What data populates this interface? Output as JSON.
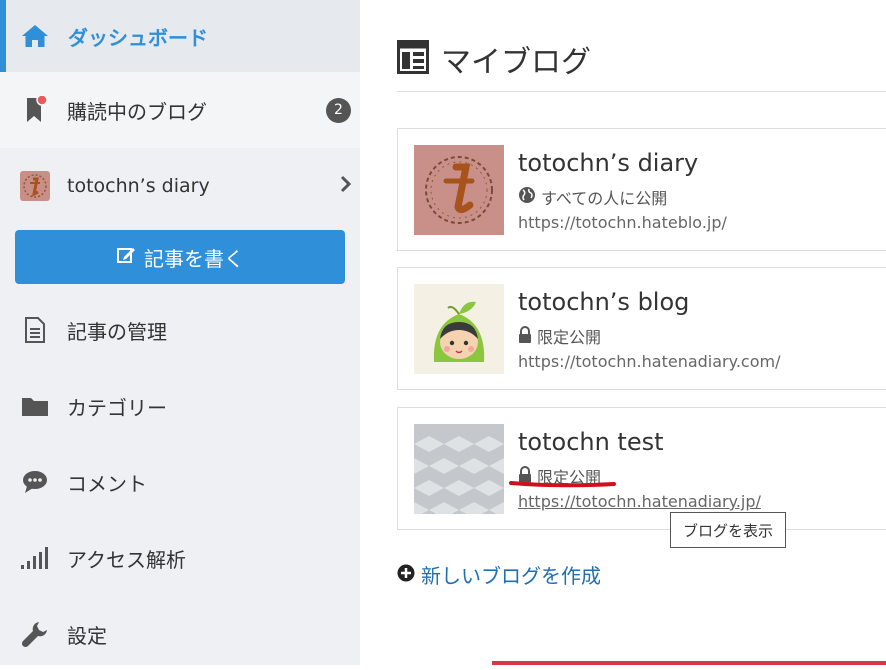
{
  "sidebar": {
    "items": [
      {
        "label": "ダッシュボード",
        "icon": "home-icon"
      },
      {
        "label": "購読中のブログ",
        "icon": "bookmark-icon",
        "badge": "2"
      },
      {
        "label": "totochn’s diary",
        "icon": "blog-avatar-icon"
      },
      {
        "label": "記事の管理",
        "icon": "document-icon"
      },
      {
        "label": "カテゴリー",
        "icon": "folder-icon"
      },
      {
        "label": "コメント",
        "icon": "comment-icon"
      },
      {
        "label": "アクセス解析",
        "icon": "bar-chart-icon"
      },
      {
        "label": "設定",
        "icon": "wrench-icon"
      }
    ],
    "write_button": "記事を書く"
  },
  "main": {
    "title": "マイブログ",
    "blogs": [
      {
        "name": "totochn’s diary",
        "visibility": "すべての人に公開",
        "visibility_icon": "globe-icon",
        "url": "https://totochn.hateblo.jp/"
      },
      {
        "name": "totochn’s blog",
        "visibility": "限定公開",
        "visibility_icon": "lock-icon",
        "url": "https://totochn.hatenadiary.com/"
      },
      {
        "name": "totochn test",
        "visibility": "限定公開",
        "visibility_icon": "lock-icon",
        "url": "https://totochn.hatenadiary.jp/"
      }
    ],
    "new_blog": "新しいブログを作成",
    "tooltip": "ブログを表示"
  },
  "colors": {
    "accent": "#2f8fd8",
    "sidebar_bg": "#eef0f3",
    "link": "#1f6fb5",
    "annotation_red": "#d0101f"
  }
}
